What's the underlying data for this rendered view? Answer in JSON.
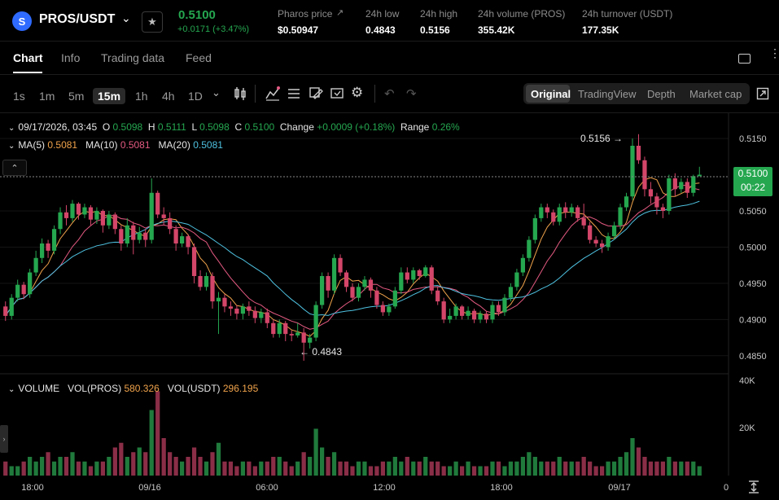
{
  "header": {
    "pair": "PROS/USDT",
    "logo_glyph": "S",
    "price": "0.5100",
    "change": "+0.0171 (+3.47%)",
    "stats": [
      {
        "label": "Pharos price",
        "value": "$0.50947"
      },
      {
        "label": "24h low",
        "value": "0.4843"
      },
      {
        "label": "24h high",
        "value": "0.5156"
      },
      {
        "label": "24h volume (PROS)",
        "value": "355.42K"
      },
      {
        "label": "24h turnover (USDT)",
        "value": "177.35K"
      }
    ],
    "colors": {
      "up": "#25a750",
      "down": "#d4456a",
      "brand": "#2f6bff"
    }
  },
  "tabs": [
    {
      "label": "Chart"
    },
    {
      "label": "Info"
    },
    {
      "label": "Trading data"
    },
    {
      "label": "Feed"
    }
  ],
  "toolbar": {
    "timeframes": [
      "1s",
      "1m",
      "5m",
      "15m",
      "1h",
      "4h",
      "1D"
    ],
    "active_timeframe": "15m",
    "views": [
      "Original",
      "TradingView",
      "Depth",
      "Market cap"
    ],
    "active_view": "Original",
    "icons": [
      "candle-type-icon",
      "indicator-icon",
      "settings-list-icon",
      "draw-icon",
      "template-icon",
      "gear-icon",
      "undo-icon",
      "redo-icon",
      "fullscreen-icon"
    ]
  },
  "legend": {
    "date": "09/17/2026, 03:45",
    "o_label": "O",
    "o": "0.5098",
    "h_label": "H",
    "h": "0.5111",
    "l_label": "L",
    "l": "0.5098",
    "c_label": "C",
    "c": "0.5100",
    "change_label": "Change",
    "change": "+0.0009 (+0.18%)",
    "range_label": "Range",
    "range": "0.26%",
    "ma5_label": "MA(5)",
    "ma5": "0.5081",
    "ma10_label": "MA(10)",
    "ma10": "0.5081",
    "ma20_label": "MA(20)",
    "ma20": "0.5081"
  },
  "volume_legend": {
    "label": "VOLUME",
    "pros_label": "VOL(PROS)",
    "pros": "580.326",
    "usdt_label": "VOL(USDT)",
    "usdt": "296.195"
  },
  "price_tag": {
    "price": "0.5100",
    "countdown": "00:22"
  },
  "annotations": {
    "high": "0.5156",
    "low": "0.4843"
  },
  "chart_data": {
    "type": "candlestick",
    "y_ticks": [
      "0.5150",
      "0.5050",
      "0.5000",
      "0.4950",
      "0.4900",
      "0.4850"
    ],
    "ylim": [
      0.4825,
      0.5185
    ],
    "volume_ticks": [
      "40K",
      "20K"
    ],
    "x_ticks": [
      "18:00",
      "09/16",
      "06:00",
      "12:00",
      "18:00",
      "09/17",
      "0"
    ],
    "last_price": 0.51,
    "candles": [
      [
        0.4918,
        0.4905,
        0.4925,
        0.4898
      ],
      [
        0.4905,
        0.493,
        0.4935,
        0.49
      ],
      [
        0.493,
        0.4948,
        0.4955,
        0.4925
      ],
      [
        0.4948,
        0.4935,
        0.4952,
        0.4928
      ],
      [
        0.4935,
        0.4965,
        0.497,
        0.493
      ],
      [
        0.4965,
        0.4985,
        0.4995,
        0.496
      ],
      [
        0.4985,
        0.5005,
        0.5012,
        0.4978
      ],
      [
        0.5005,
        0.4995,
        0.501,
        0.4985
      ],
      [
        0.4995,
        0.5025,
        0.503,
        0.499
      ],
      [
        0.5025,
        0.5048,
        0.5055,
        0.5018
      ],
      [
        0.5048,
        0.504,
        0.5058,
        0.503
      ],
      [
        0.504,
        0.506,
        0.5065,
        0.5035
      ],
      [
        0.506,
        0.5045,
        0.5062,
        0.5038
      ],
      [
        0.5045,
        0.5055,
        0.506,
        0.504
      ],
      [
        0.5055,
        0.5038,
        0.5058,
        0.503
      ],
      [
        0.5038,
        0.505,
        0.5055,
        0.5032
      ],
      [
        0.505,
        0.503,
        0.5052,
        0.502
      ],
      [
        0.503,
        0.5045,
        0.505,
        0.5025
      ],
      [
        0.5045,
        0.5025,
        0.5048,
        0.5018
      ],
      [
        0.5025,
        0.5005,
        0.503,
        0.4995
      ],
      [
        0.5005,
        0.503,
        0.504,
        0.5
      ],
      [
        0.503,
        0.501,
        0.5035,
        0.499
      ],
      [
        0.501,
        0.502,
        0.5028,
        0.5005
      ],
      [
        0.502,
        0.501,
        0.5025,
        0.5
      ],
      [
        0.501,
        0.5075,
        0.5095,
        0.5005
      ],
      [
        0.5075,
        0.5045,
        0.5078,
        0.504
      ],
      [
        0.5045,
        0.504,
        0.5055,
        0.503
      ],
      [
        0.504,
        0.5025,
        0.5048,
        0.5018
      ],
      [
        0.5025,
        0.5005,
        0.503,
        0.4995
      ],
      [
        0.5005,
        0.5015,
        0.502,
        0.5
      ],
      [
        0.5015,
        0.5,
        0.5018,
        0.499
      ],
      [
        0.5,
        0.496,
        0.5005,
        0.495
      ],
      [
        0.496,
        0.4945,
        0.4968,
        0.494
      ],
      [
        0.4945,
        0.496,
        0.4965,
        0.494
      ],
      [
        0.496,
        0.4925,
        0.4965,
        0.4915
      ],
      [
        0.4925,
        0.493,
        0.4938,
        0.488
      ],
      [
        0.493,
        0.4918,
        0.4935,
        0.491
      ],
      [
        0.4918,
        0.4915,
        0.4925,
        0.4905
      ],
      [
        0.4915,
        0.4908,
        0.492,
        0.49
      ],
      [
        0.4908,
        0.4918,
        0.4922,
        0.49
      ],
      [
        0.4918,
        0.4912,
        0.4925,
        0.4905
      ],
      [
        0.4912,
        0.4902,
        0.4918,
        0.4895
      ],
      [
        0.4902,
        0.491,
        0.4915,
        0.4895
      ],
      [
        0.491,
        0.4895,
        0.4915,
        0.4888
      ],
      [
        0.4895,
        0.488,
        0.49,
        0.4875
      ],
      [
        0.488,
        0.4895,
        0.49,
        0.4875
      ],
      [
        0.4895,
        0.488,
        0.4898,
        0.487
      ],
      [
        0.488,
        0.4878,
        0.4885,
        0.487
      ],
      [
        0.4878,
        0.4882,
        0.4895,
        0.4875
      ],
      [
        0.4882,
        0.4868,
        0.4888,
        0.4843
      ],
      [
        0.4868,
        0.4875,
        0.488,
        0.486
      ],
      [
        0.4875,
        0.492,
        0.4925,
        0.487
      ],
      [
        0.492,
        0.496,
        0.4965,
        0.4915
      ],
      [
        0.496,
        0.494,
        0.4965,
        0.493
      ],
      [
        0.494,
        0.4985,
        0.499,
        0.4935
      ],
      [
        0.4985,
        0.4965,
        0.499,
        0.496
      ],
      [
        0.4965,
        0.4945,
        0.4968,
        0.4938
      ],
      [
        0.4945,
        0.493,
        0.495,
        0.4925
      ],
      [
        0.493,
        0.4945,
        0.495,
        0.4925
      ],
      [
        0.4945,
        0.4955,
        0.496,
        0.494
      ],
      [
        0.4955,
        0.494,
        0.4958,
        0.493
      ],
      [
        0.494,
        0.492,
        0.4945,
        0.4915
      ],
      [
        0.492,
        0.491,
        0.4925,
        0.4905
      ],
      [
        0.491,
        0.4918,
        0.4922,
        0.4905
      ],
      [
        0.4918,
        0.494,
        0.4945,
        0.4915
      ],
      [
        0.494,
        0.4965,
        0.4972,
        0.4935
      ],
      [
        0.4965,
        0.4955,
        0.4972,
        0.495
      ],
      [
        0.4955,
        0.4968,
        0.4972,
        0.495
      ],
      [
        0.4968,
        0.496,
        0.497,
        0.4955
      ],
      [
        0.496,
        0.4972,
        0.4975,
        0.4958
      ],
      [
        0.4972,
        0.494,
        0.4975,
        0.4935
      ],
      [
        0.494,
        0.4925,
        0.4945,
        0.492
      ],
      [
        0.4925,
        0.49,
        0.493,
        0.4895
      ],
      [
        0.49,
        0.4905,
        0.4915,
        0.4895
      ],
      [
        0.4905,
        0.4918,
        0.4922,
        0.49
      ],
      [
        0.4918,
        0.4905,
        0.492,
        0.49
      ],
      [
        0.4905,
        0.4912,
        0.4918,
        0.49
      ],
      [
        0.4912,
        0.49,
        0.4915,
        0.4895
      ],
      [
        0.49,
        0.4908,
        0.4912,
        0.4895
      ],
      [
        0.4908,
        0.49,
        0.4912,
        0.4895
      ],
      [
        0.49,
        0.492,
        0.4925,
        0.4895
      ],
      [
        0.492,
        0.491,
        0.4925,
        0.4905
      ],
      [
        0.491,
        0.493,
        0.4935,
        0.4905
      ],
      [
        0.493,
        0.4945,
        0.495,
        0.4925
      ],
      [
        0.4945,
        0.4965,
        0.497,
        0.494
      ],
      [
        0.4965,
        0.4985,
        0.499,
        0.496
      ],
      [
        0.4985,
        0.501,
        0.5015,
        0.498
      ],
      [
        0.501,
        0.504,
        0.5045,
        0.5005
      ],
      [
        0.504,
        0.5055,
        0.506,
        0.5035
      ],
      [
        0.5055,
        0.5048,
        0.506,
        0.504
      ],
      [
        0.5048,
        0.5035,
        0.5052,
        0.503
      ],
      [
        0.5035,
        0.5055,
        0.506,
        0.503
      ],
      [
        0.5055,
        0.5048,
        0.5062,
        0.504
      ],
      [
        0.5048,
        0.5055,
        0.506,
        0.5042
      ],
      [
        0.5055,
        0.504,
        0.5058,
        0.5035
      ],
      [
        0.504,
        0.503,
        0.506,
        0.5025
      ],
      [
        0.503,
        0.501,
        0.5035,
        0.5005
      ],
      [
        0.501,
        0.5005,
        0.5015,
        0.5
      ],
      [
        0.5005,
        0.5,
        0.501,
        0.4992
      ],
      [
        0.5,
        0.5015,
        0.502,
        0.4995
      ],
      [
        0.5015,
        0.503,
        0.5035,
        0.501
      ],
      [
        0.503,
        0.5055,
        0.506,
        0.5025
      ],
      [
        0.5055,
        0.507,
        0.5075,
        0.505
      ],
      [
        0.507,
        0.514,
        0.515,
        0.5065
      ],
      [
        0.514,
        0.512,
        0.5156,
        0.5115
      ],
      [
        0.512,
        0.508,
        0.5125,
        0.507
      ],
      [
        0.508,
        0.507,
        0.509,
        0.506
      ],
      [
        0.507,
        0.5055,
        0.5075,
        0.5045
      ],
      [
        0.5055,
        0.505,
        0.506,
        0.504
      ],
      [
        0.505,
        0.5095,
        0.51,
        0.5045
      ],
      [
        0.5095,
        0.508,
        0.5102,
        0.507
      ],
      [
        0.508,
        0.509,
        0.5095,
        0.5075
      ],
      [
        0.509,
        0.5075,
        0.5095,
        0.5068
      ],
      [
        0.5075,
        0.5098,
        0.51,
        0.507
      ],
      [
        0.5098,
        0.51,
        0.5111,
        0.5098
      ]
    ],
    "volumes": [
      3,
      2,
      2,
      3,
      4,
      3,
      4,
      5,
      3,
      4,
      4,
      5,
      3,
      3,
      2,
      3,
      3,
      4,
      6,
      7,
      4,
      5,
      6,
      5,
      14,
      18,
      8,
      5,
      4,
      3,
      4,
      6,
      4,
      3,
      5,
      7,
      3,
      3,
      2,
      3,
      3,
      2,
      3,
      3,
      4,
      4,
      3,
      2,
      3,
      5,
      4,
      10,
      6,
      4,
      5,
      3,
      3,
      2,
      3,
      3,
      2,
      2,
      3,
      3,
      4,
      3,
      4,
      3,
      3,
      4,
      3,
      3,
      2,
      2,
      3,
      2,
      3,
      2,
      2,
      2,
      3,
      3,
      2,
      3,
      3,
      4,
      5,
      4,
      3,
      3,
      3,
      4,
      3,
      3,
      3,
      4,
      3,
      2,
      2,
      3,
      3,
      4,
      5,
      8,
      6,
      4,
      3,
      3,
      3,
      4,
      3,
      3,
      3,
      3,
      2
    ],
    "ma_colors": {
      "ma5": "#f0a34b",
      "ma10": "#e45a82",
      "ma20": "#4ec1e0"
    }
  }
}
